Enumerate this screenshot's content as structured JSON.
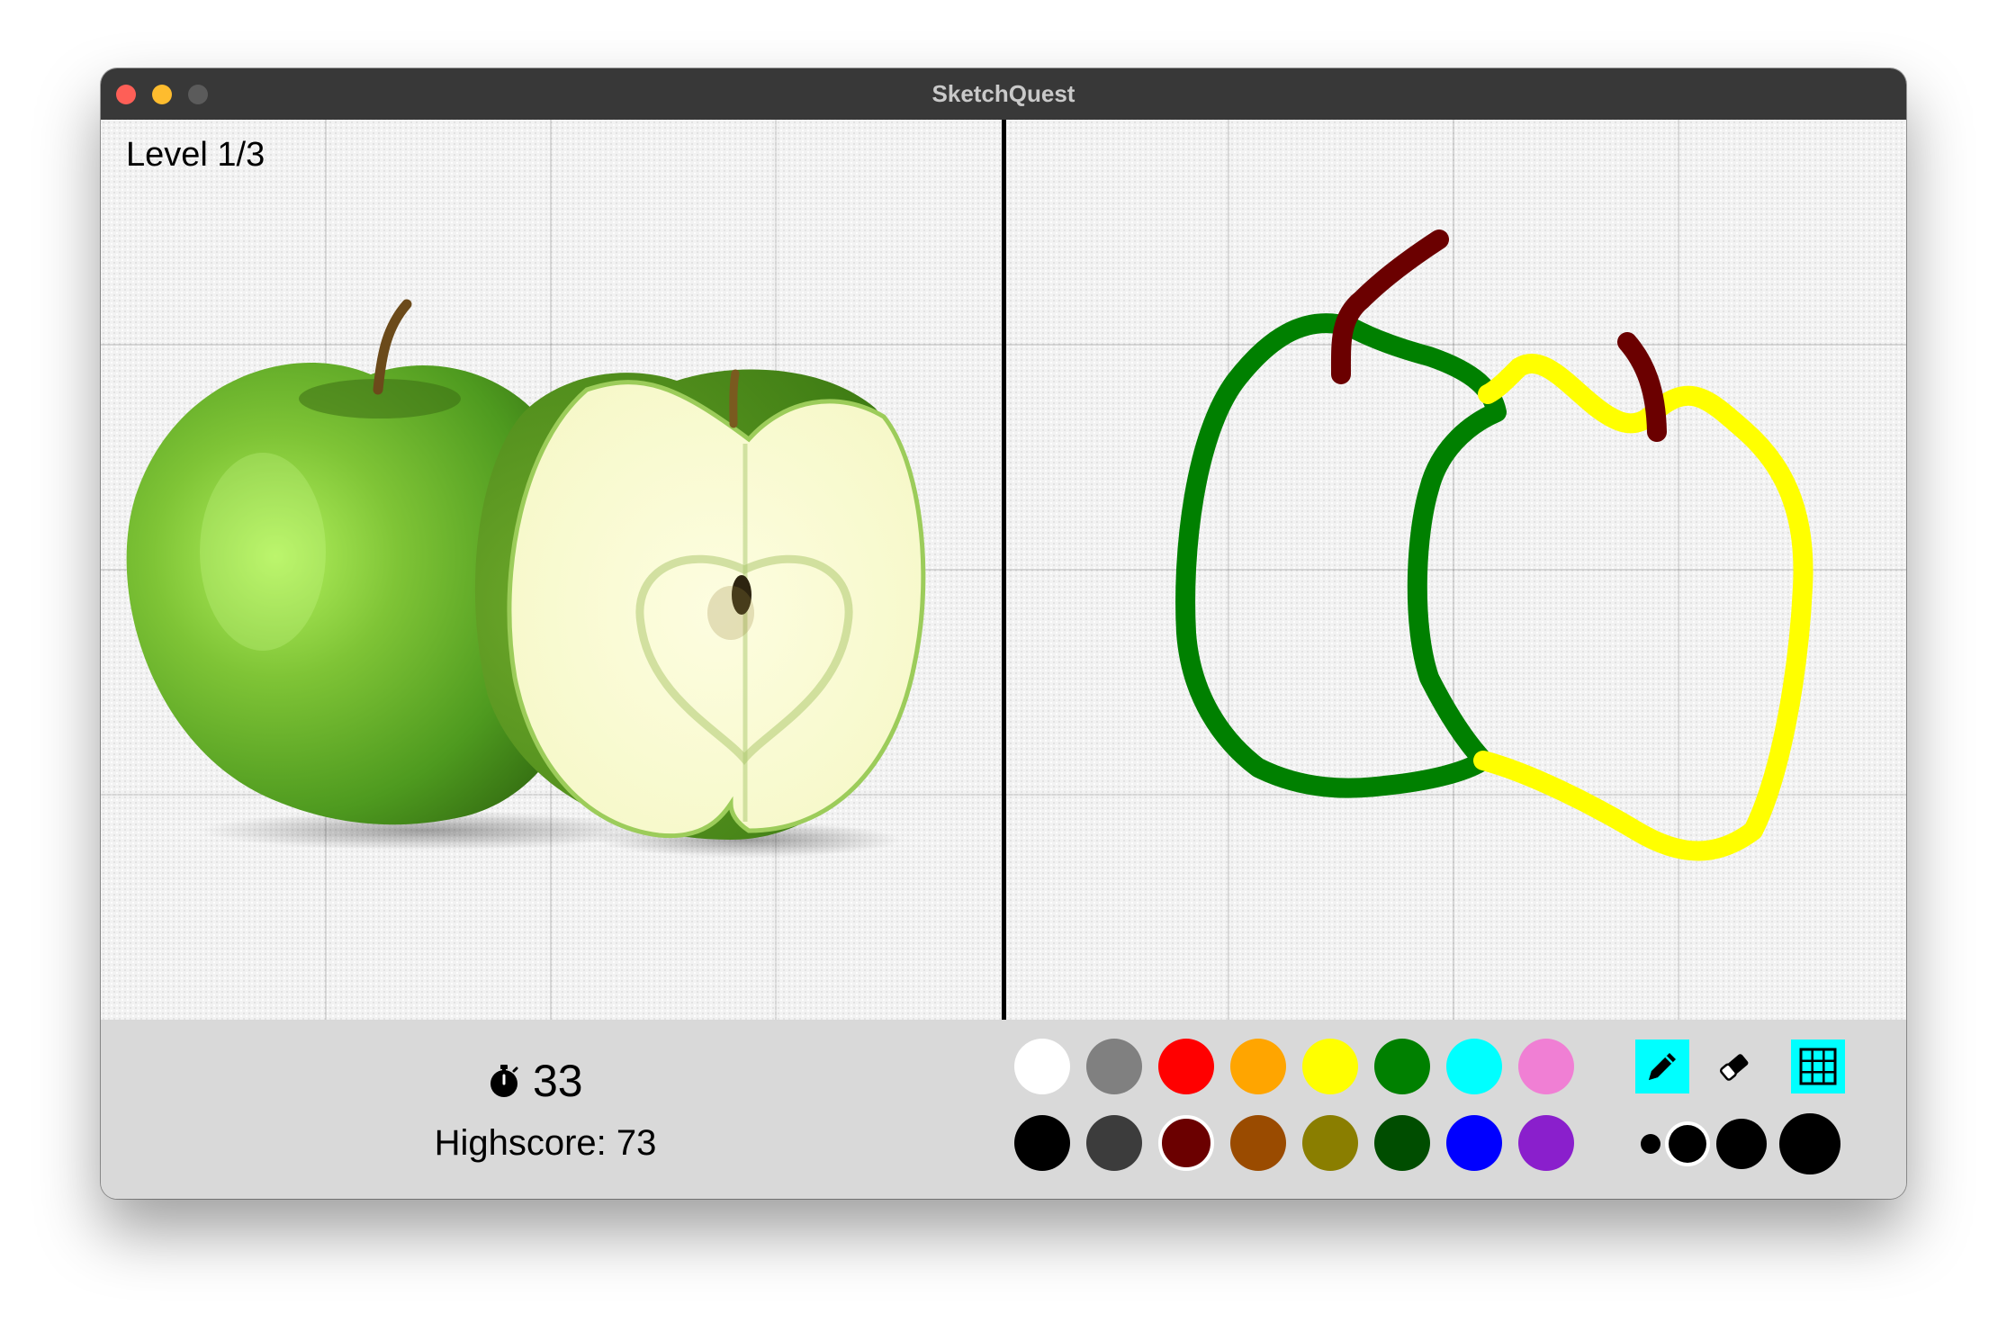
{
  "window": {
    "title": "SketchQuest"
  },
  "game": {
    "level_label": "Level 1/3",
    "timer": "33",
    "highscore": "Highscore: 73"
  },
  "palette": {
    "row1": [
      "#ffffff",
      "#808080",
      "#ff0000",
      "#ffa500",
      "#ffff00",
      "#008000",
      "#00ffff",
      "#f07fd4"
    ],
    "row2": [
      "#000000",
      "#3c3c3c",
      "#6b0000",
      "#9a4b00",
      "#8a7e00",
      "#004d00",
      "#0000ff",
      "#8a1fcc"
    ],
    "selected": "#6b0000"
  },
  "tools": {
    "items": [
      {
        "name": "pencil-icon",
        "active": true
      },
      {
        "name": "eraser-icon",
        "active": false
      },
      {
        "name": "grid-icon",
        "active": true
      }
    ]
  },
  "brush_sizes": {
    "selected_index": 1,
    "count": 4
  },
  "drawing": {
    "stroke_colors": {
      "green": "#008000",
      "yellow": "#ffff00",
      "stem": "#6b0000"
    }
  }
}
